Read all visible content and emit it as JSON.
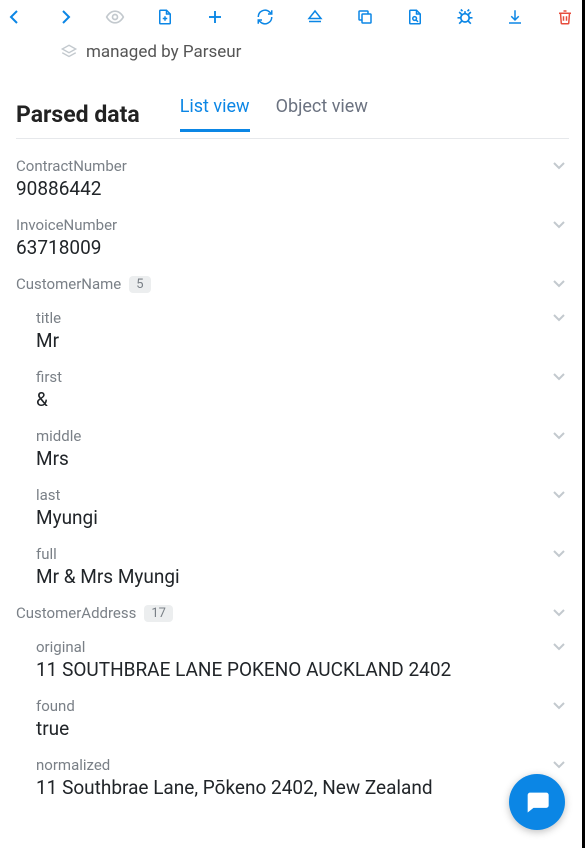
{
  "managed_label": "managed by Parseur",
  "header_title": "Parsed data",
  "tabs": {
    "list": "List view",
    "object": "Object view"
  },
  "fields": {
    "contractNumber": {
      "label": "ContractNumber",
      "value": "90886442"
    },
    "invoiceNumber": {
      "label": "InvoiceNumber",
      "value": "63718009"
    },
    "customerName": {
      "label": "CustomerName",
      "badge": "5",
      "title": {
        "label": "title",
        "value": "Mr"
      },
      "first": {
        "label": "first",
        "value": "&"
      },
      "middle": {
        "label": "middle",
        "value": "Mrs"
      },
      "last": {
        "label": "last",
        "value": "Myungi"
      },
      "full": {
        "label": "full",
        "value": "Mr & Mrs Myungi"
      }
    },
    "customerAddress": {
      "label": "CustomerAddress",
      "badge": "17",
      "original": {
        "label": "original",
        "value": "11 SOUTHBRAE LANE POKENO AUCKLAND 2402"
      },
      "found": {
        "label": "found",
        "value": "true"
      },
      "normalized": {
        "label": "normalized",
        "value": "11 Southbrae Lane, Pōkeno 2402, New Zealand"
      }
    }
  }
}
